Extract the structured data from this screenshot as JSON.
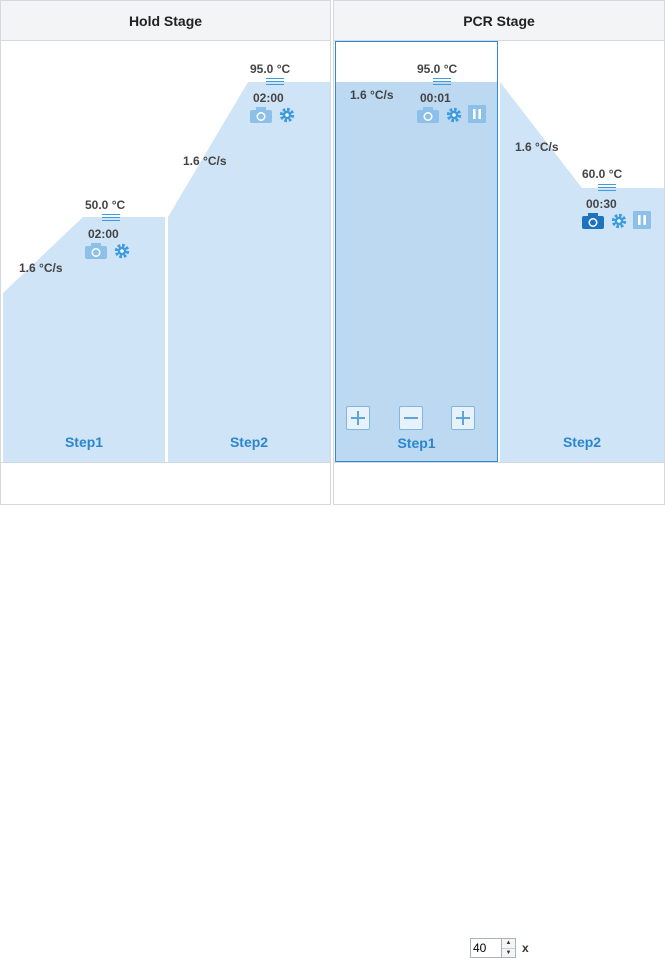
{
  "stages": [
    {
      "title": "Hold Stage",
      "steps": [
        {
          "label": "Step1",
          "temperature": "50.0 °C",
          "time": "02:00",
          "ramp_rate": "1.6 °C/s",
          "camera_active": false,
          "has_pause": false
        },
        {
          "label": "Step2",
          "temperature": "95.0 °C",
          "time": "02:00",
          "ramp_rate": "1.6 °C/s",
          "camera_active": false,
          "has_pause": false
        }
      ]
    },
    {
      "title": "PCR Stage",
      "cycles": "40",
      "cycles_suffix": "x",
      "steps": [
        {
          "label": "Step1",
          "temperature": "95.0 °C",
          "time": "00:01",
          "ramp_rate": "1.6 °C/s",
          "camera_active": false,
          "has_pause": true,
          "selected": true
        },
        {
          "label": "Step2",
          "temperature": "60.0 °C",
          "time": "00:30",
          "ramp_rate": "1.6 °C/s",
          "camera_active": true,
          "has_pause": true
        }
      ]
    }
  ],
  "colors": {
    "fill": "#cfe4f6",
    "fill_selected": "#bcd9f1",
    "accent": "#2b86cf",
    "icon": "#3d9be0",
    "icon_muted": "#8dc0e8"
  },
  "icons": {
    "camera": "camera-icon",
    "settings": "gear-icon",
    "pause": "pause-icon",
    "add": "plus-icon",
    "remove": "minus-icon"
  }
}
